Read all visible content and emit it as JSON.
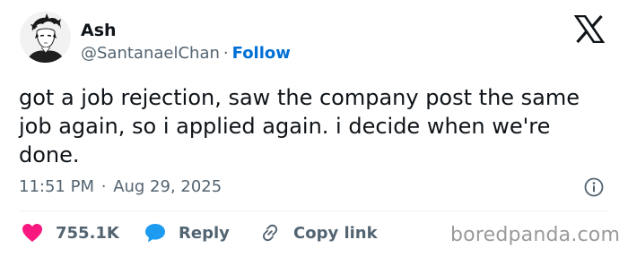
{
  "author": {
    "display_name": "Ash",
    "handle": "@SantanaelChan",
    "separator": "·",
    "follow_label": "Follow"
  },
  "tweet": {
    "text": "got a job rejection, saw the company post the same job again, so i applied again. i decide when we're done.",
    "time": "11:51 PM",
    "separator": "·",
    "date": "Aug 29, 2025"
  },
  "actions": {
    "like_count": "755.1K",
    "reply_label": "Reply",
    "copy_label": "Copy link"
  },
  "icons": {
    "brand": "x-logo-icon",
    "info": "info-icon",
    "like": "heart-icon",
    "reply": "reply-bubble-icon",
    "copy": "link-icon"
  },
  "colors": {
    "follow": "#006fd6",
    "heart": "#f91880",
    "reply_bubble": "#1d9bf0",
    "muted": "#536471",
    "text": "#0f1419"
  },
  "watermark": "boredpanda.com"
}
